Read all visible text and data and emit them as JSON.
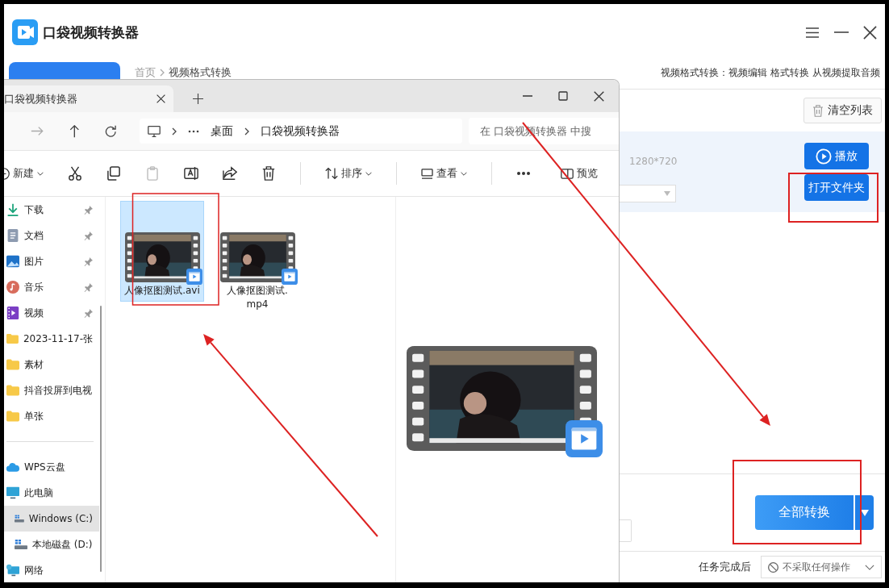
{
  "app": {
    "title": "口袋视频转换器",
    "breadcrumb": [
      "首页",
      "视频格式转换"
    ],
    "header_links": "视频格式转换：视频编辑 格式转换 从视频提取音频",
    "clear_button": "清空列表",
    "file_row": {
      "resolution": "1280*720",
      "play_button": "播放",
      "open_folder_button": "打开文件夹"
    },
    "convert_all_button": "全部转换",
    "after_task": {
      "label": "任务完成后",
      "value": "不采取任何操作"
    }
  },
  "explorer": {
    "tab": "口袋视频转换器",
    "path": [
      "桌面",
      "口袋视频转换器"
    ],
    "search_placeholder": "在 口袋视频转换器 中搜",
    "toolbar": [
      {
        "kind": "menu",
        "label": "新建"
      },
      {
        "kind": "icon",
        "disabled": false
      },
      {
        "kind": "icon",
        "disabled": false
      },
      {
        "kind": "icon",
        "disabled": true
      },
      {
        "kind": "icon",
        "disabled": false
      },
      {
        "kind": "icon",
        "disabled": false
      },
      {
        "kind": "icon",
        "disabled": false
      },
      {
        "kind": "menu",
        "label": "排序"
      },
      {
        "kind": "menu",
        "label": "查看"
      },
      {
        "kind": "more"
      }
    ],
    "preview_button": "预览",
    "nav": [
      {
        "kind": "download",
        "label": "下载",
        "pinned": true,
        "selected": false
      },
      {
        "kind": "docs",
        "label": "文档",
        "pinned": true,
        "selected": false
      },
      {
        "kind": "images",
        "label": "图片",
        "pinned": true,
        "selected": false
      },
      {
        "kind": "music",
        "label": "音乐",
        "pinned": true,
        "selected": false
      },
      {
        "kind": "videos",
        "label": "视频",
        "pinned": true,
        "selected": false
      },
      {
        "kind": "folder",
        "label": "2023-11-17-张",
        "pinned": false,
        "selected": false
      },
      {
        "kind": "folder",
        "label": "素材",
        "pinned": false,
        "selected": false
      },
      {
        "kind": "folder",
        "label": "抖音投屏到电视",
        "pinned": false,
        "selected": false
      },
      {
        "kind": "folder",
        "label": "单张",
        "pinned": false,
        "selected": false
      },
      {
        "kind": "divider"
      },
      {
        "kind": "cloud",
        "label": "WPS云盘",
        "pinned": false,
        "selected": false
      },
      {
        "kind": "computer",
        "label": "此电脑",
        "pinned": false,
        "selected": false,
        "children": [
          {
            "kind": "drive",
            "label": "Windows (C:)",
            "pinned": false,
            "selected": true
          },
          {
            "kind": "drive",
            "label": "本地磁盘 (D:)",
            "pinned": false,
            "selected": false
          }
        ]
      },
      {
        "kind": "network",
        "label": "网络",
        "pinned": false,
        "selected": false
      }
    ],
    "files": [
      {
        "name": "人像抠图测试.avi",
        "selected": true
      },
      {
        "name": "人像抠图测试.mp4",
        "selected": false
      }
    ]
  }
}
